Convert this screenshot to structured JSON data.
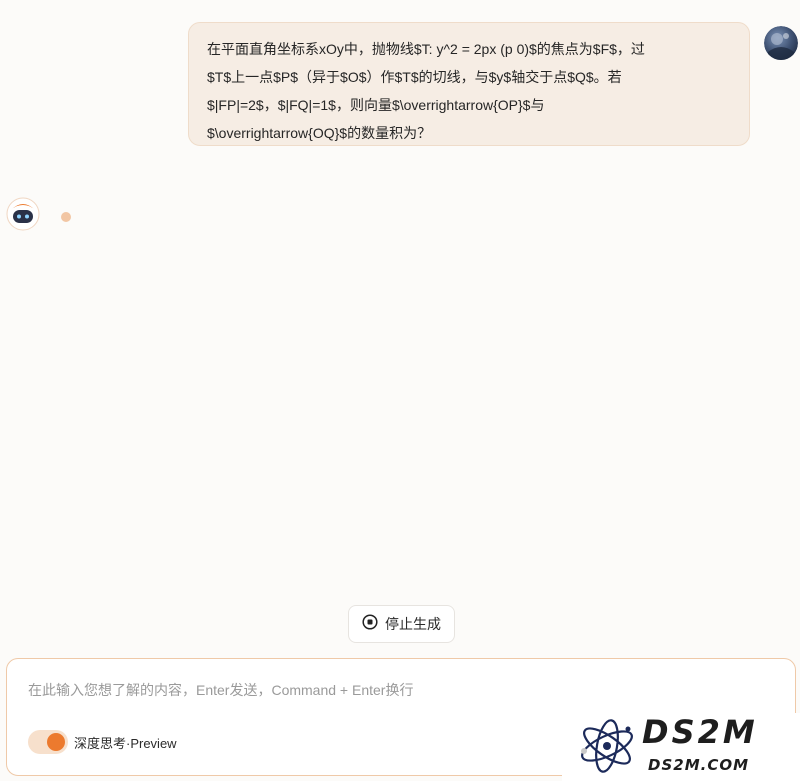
{
  "conversation": {
    "user_message": {
      "lines": [
        "在平面直角坐标系xOy中，抛物线$T: y^2 = 2px (p 0)$的焦点为$F$，过",
        "$T$上一点$P$（异于$O$）作$T$的切线，与$y$轴交于点$Q$。若",
        "$|FP|=2$，$|FQ|=1$，则向量$\\overrightarrow{OP}$与",
        "$\\overrightarrow{OQ}$的数量积为？"
      ]
    },
    "assistant": {
      "status_icon": "typing-dot"
    }
  },
  "controls": {
    "stop_label": "停止生成",
    "stop_icon": "stop-circle-icon"
  },
  "composer": {
    "placeholder": "在此输入您想了解的内容，Enter发送，Command + Enter换行",
    "value": "",
    "deep_think_label": "深度思考·Preview",
    "deep_think_enabled": true
  },
  "watermark": {
    "title": "DS2M",
    "subtitle": "DS2M.COM"
  },
  "colors": {
    "accent": "#ec7a2e",
    "user_bubble": "#f6ede4",
    "background": "#fcfbf9"
  }
}
